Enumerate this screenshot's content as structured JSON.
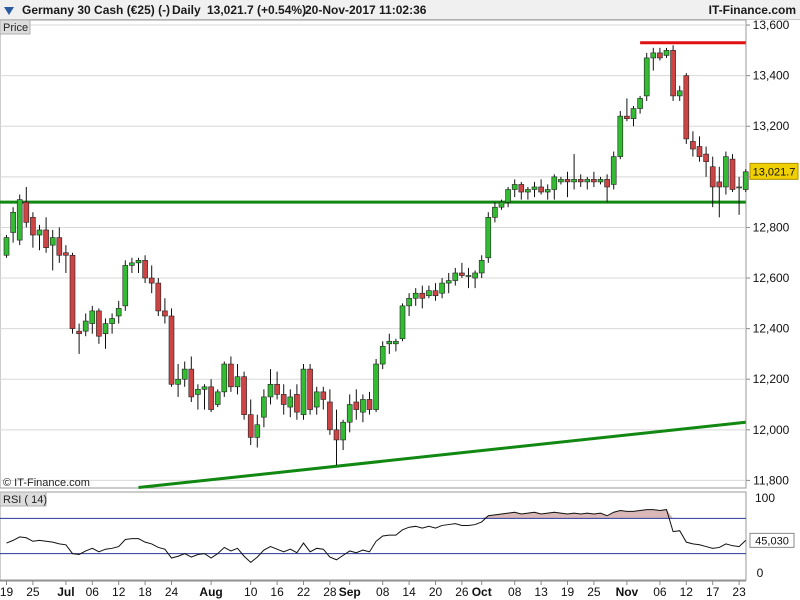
{
  "header": {
    "instrument": "Germany 30 Cash (€25) (-)",
    "period": "Daily",
    "quote": "13,021.7 (+0.54%)",
    "datetime": "20-Nov-2017 11:02:36",
    "brand": "IT-Finance.com"
  },
  "price_panel": {
    "label": "Price",
    "copyright": "© IT-Finance.com"
  },
  "rsi_panel": {
    "label": "RSI ( 14)"
  },
  "chart_data": [
    {
      "type": "candlestick",
      "title": "Germany 30 Cash (€25) (-)",
      "ylim": [
        11770,
        13620
      ],
      "y_ticks": [
        11800,
        12000,
        12200,
        12400,
        12600,
        12800,
        13000,
        13200,
        13400,
        13600
      ],
      "y_tick_labels": [
        "11,800",
        "12,000",
        "12,200",
        "12,400",
        "12,600",
        "12,800",
        "",
        "13,200",
        "13,400",
        "13,600"
      ],
      "last_price": 13021.7,
      "last_price_label": "13,021.7",
      "x_ticks": [
        {
          "label": "19",
          "idx": 0,
          "bold": false
        },
        {
          "label": "25",
          "idx": 4,
          "bold": false
        },
        {
          "label": "Jul",
          "idx": 9,
          "bold": true
        },
        {
          "label": "06",
          "idx": 13,
          "bold": false
        },
        {
          "label": "12",
          "idx": 17,
          "bold": false
        },
        {
          "label": "18",
          "idx": 21,
          "bold": false
        },
        {
          "label": "24",
          "idx": 25,
          "bold": false
        },
        {
          "label": "Aug",
          "idx": 31,
          "bold": true
        },
        {
          "label": "10",
          "idx": 37,
          "bold": false
        },
        {
          "label": "16",
          "idx": 41,
          "bold": false
        },
        {
          "label": "22",
          "idx": 45,
          "bold": false
        },
        {
          "label": "28",
          "idx": 49,
          "bold": false
        },
        {
          "label": "Sep",
          "idx": 52,
          "bold": true
        },
        {
          "label": "08",
          "idx": 57,
          "bold": false
        },
        {
          "label": "14",
          "idx": 61,
          "bold": false
        },
        {
          "label": "20",
          "idx": 65,
          "bold": false
        },
        {
          "label": "26",
          "idx": 69,
          "bold": false
        },
        {
          "label": "Oct",
          "idx": 72,
          "bold": true
        },
        {
          "label": "08",
          "idx": 77,
          "bold": false
        },
        {
          "label": "13",
          "idx": 81,
          "bold": false
        },
        {
          "label": "19",
          "idx": 85,
          "bold": false
        },
        {
          "label": "25",
          "idx": 89,
          "bold": false
        },
        {
          "label": "Nov",
          "idx": 94,
          "bold": true
        },
        {
          "label": "06",
          "idx": 99,
          "bold": false
        },
        {
          "label": "12",
          "idx": 103,
          "bold": false
        },
        {
          "label": "17",
          "idx": 107,
          "bold": false
        },
        {
          "label": "23",
          "idx": 111,
          "bold": false
        }
      ],
      "candles": [
        [
          12690,
          12770,
          12680,
          12760
        ],
        [
          12780,
          12880,
          12740,
          12860
        ],
        [
          12750,
          12930,
          12730,
          12910
        ],
        [
          12900,
          12960,
          12800,
          12820
        ],
        [
          12840,
          12860,
          12720,
          12770
        ],
        [
          12770,
          12810,
          12710,
          12790
        ],
        [
          12790,
          12840,
          12700,
          12720
        ],
        [
          12730,
          12790,
          12630,
          12760
        ],
        [
          12760,
          12800,
          12660,
          12690
        ],
        [
          12700,
          12730,
          12620,
          12690
        ],
        [
          12690,
          12700,
          12380,
          12400
        ],
        [
          12390,
          12420,
          12300,
          12380
        ],
        [
          12390,
          12460,
          12370,
          12430
        ],
        [
          12420,
          12490,
          12380,
          12470
        ],
        [
          12470,
          12480,
          12340,
          12370
        ],
        [
          12380,
          12440,
          12320,
          12420
        ],
        [
          12420,
          12460,
          12380,
          12440
        ],
        [
          12450,
          12510,
          12420,
          12480
        ],
        [
          12490,
          12670,
          12470,
          12650
        ],
        [
          12650,
          12680,
          12620,
          12660
        ],
        [
          12660,
          12680,
          12620,
          12670
        ],
        [
          12670,
          12690,
          12580,
          12600
        ],
        [
          12600,
          12650,
          12540,
          12580
        ],
        [
          12580,
          12600,
          12450,
          12470
        ],
        [
          12470,
          12520,
          12420,
          12450
        ],
        [
          12450,
          12480,
          12170,
          12180
        ],
        [
          12180,
          12260,
          12130,
          12200
        ],
        [
          12200,
          12270,
          12170,
          12240
        ],
        [
          12240,
          12290,
          12110,
          12130
        ],
        [
          12140,
          12180,
          12080,
          12160
        ],
        [
          12160,
          12180,
          12080,
          12170
        ],
        [
          12170,
          12200,
          12070,
          12080
        ],
        [
          12100,
          12160,
          12090,
          12150
        ],
        [
          12150,
          12270,
          12130,
          12260
        ],
        [
          12260,
          12290,
          12150,
          12170
        ],
        [
          12170,
          12260,
          12140,
          12210
        ],
        [
          12210,
          12230,
          12040,
          12060
        ],
        [
          12060,
          12120,
          11940,
          11970
        ],
        [
          11970,
          12060,
          11930,
          12020
        ],
        [
          12050,
          12160,
          12010,
          12130
        ],
        [
          12130,
          12240,
          12100,
          12180
        ],
        [
          12180,
          12230,
          12120,
          12140
        ],
        [
          12140,
          12180,
          12060,
          12100
        ],
        [
          12090,
          12160,
          12050,
          12130
        ],
        [
          12140,
          12180,
          12040,
          12070
        ],
        [
          12060,
          12260,
          12040,
          12240
        ],
        [
          12240,
          12260,
          12060,
          12080
        ],
        [
          12090,
          12170,
          12060,
          12150
        ],
        [
          12150,
          12170,
          12080,
          12120
        ],
        [
          12110,
          12160,
          11980,
          12000
        ],
        [
          12000,
          12080,
          11860,
          11960
        ],
        [
          11960,
          12040,
          11920,
          12030
        ],
        [
          12030,
          12140,
          11990,
          12100
        ],
        [
          12110,
          12160,
          12040,
          12080
        ],
        [
          12070,
          12140,
          12030,
          12120
        ],
        [
          12120,
          12150,
          12060,
          12080
        ],
        [
          12080,
          12280,
          12070,
          12260
        ],
        [
          12260,
          12350,
          12240,
          12330
        ],
        [
          12340,
          12380,
          12300,
          12350
        ],
        [
          12340,
          12360,
          12310,
          12350
        ],
        [
          12360,
          12500,
          12350,
          12490
        ],
        [
          12490,
          12540,
          12450,
          12520
        ],
        [
          12520,
          12560,
          12490,
          12540
        ],
        [
          12540,
          12570,
          12480,
          12520
        ],
        [
          12530,
          12570,
          12520,
          12550
        ],
        [
          12550,
          12580,
          12510,
          12530
        ],
        [
          12540,
          12600,
          12520,
          12580
        ],
        [
          12580,
          12620,
          12540,
          12590
        ],
        [
          12590,
          12640,
          12570,
          12620
        ],
        [
          12620,
          12660,
          12600,
          12610
        ],
        [
          12610,
          12640,
          12560,
          12610
        ],
        [
          12600,
          12630,
          12560,
          12620
        ],
        [
          12620,
          12690,
          12600,
          12670
        ],
        [
          12680,
          12860,
          12660,
          12840
        ],
        [
          12840,
          12900,
          12820,
          12880
        ],
        [
          12880,
          12910,
          12870,
          12900
        ],
        [
          12900,
          12960,
          12880,
          12950
        ],
        [
          12950,
          12990,
          12920,
          12970
        ],
        [
          12970,
          12980,
          12910,
          12940
        ],
        [
          12940,
          12960,
          12910,
          12950
        ],
        [
          12950,
          12980,
          12920,
          12960
        ],
        [
          12960,
          12990,
          12930,
          12940
        ],
        [
          12940,
          12970,
          12910,
          12950
        ],
        [
          12950,
          13010,
          12910,
          13000
        ],
        [
          12980,
          13000,
          12970,
          12990
        ],
        [
          12990,
          13020,
          12920,
          12980
        ],
        [
          12980,
          13090,
          12950,
          12990
        ],
        [
          12990,
          13010,
          12960,
          12980
        ],
        [
          12980,
          13000,
          12950,
          12990
        ],
        [
          12990,
          13020,
          12960,
          12980
        ],
        [
          12980,
          13000,
          12970,
          12990
        ],
        [
          12990,
          13010,
          12900,
          12960
        ],
        [
          12970,
          13100,
          12950,
          13080
        ],
        [
          13080,
          13260,
          13070,
          13240
        ],
        [
          13240,
          13310,
          13220,
          13230
        ],
        [
          13230,
          13280,
          13200,
          13270
        ],
        [
          13270,
          13320,
          13250,
          13310
        ],
        [
          13320,
          13490,
          13300,
          13470
        ],
        [
          13470,
          13510,
          13420,
          13490
        ],
        [
          13490,
          13510,
          13460,
          13470
        ],
        [
          13480,
          13510,
          13470,
          13500
        ],
        [
          13500,
          13520,
          13300,
          13320
        ],
        [
          13320,
          13360,
          13300,
          13340
        ],
        [
          13400,
          13410,
          13130,
          13150
        ],
        [
          13140,
          13180,
          13080,
          13110
        ],
        [
          13120,
          13160,
          13060,
          13080
        ],
        [
          13090,
          13120,
          13000,
          13060
        ],
        [
          13040,
          13080,
          12880,
          12960
        ],
        [
          12980,
          13040,
          12840,
          12960
        ],
        [
          12960,
          13100,
          12930,
          13080
        ],
        [
          13070,
          13090,
          12940,
          12950
        ],
        [
          12960,
          13000,
          12850,
          12960
        ],
        [
          12950,
          13030,
          12940,
          13020
        ]
      ],
      "lines": [
        {
          "name": "resistance",
          "color": "#e01010",
          "from": [
            96,
            13530
          ],
          "to": [
            112,
            13530
          ]
        },
        {
          "name": "support-horizontal",
          "color": "#118811",
          "from": [
            -2,
            12900
          ],
          "to": [
            112,
            12900
          ]
        },
        {
          "name": "trendline",
          "color": "#118811",
          "from": [
            20,
            11772
          ],
          "to": [
            112,
            12030
          ]
        }
      ],
      "colors": {
        "up": "#33bb33",
        "down": "#cc4444",
        "wick": "#111111"
      }
    },
    {
      "type": "line",
      "title": "RSI ( 14)",
      "ylim": [
        0,
        100
      ],
      "y_tick_labels": [
        "100",
        "0"
      ],
      "levels": [
        70,
        30
      ],
      "last_value": 45.03,
      "last_value_label": "45,030",
      "overbought_fill": "#dbb8b8",
      "values": [
        42,
        45,
        49,
        48,
        44,
        45,
        44,
        43,
        41,
        40,
        30,
        29,
        33,
        36,
        32,
        35,
        36,
        38,
        46,
        47,
        47,
        43,
        41,
        37,
        35,
        25,
        27,
        30,
        26,
        29,
        30,
        25,
        30,
        37,
        33,
        36,
        27,
        20,
        26,
        34,
        38,
        35,
        32,
        35,
        31,
        42,
        32,
        36,
        35,
        26,
        23,
        28,
        33,
        31,
        34,
        32,
        44,
        50,
        51,
        51,
        57,
        60,
        61,
        59,
        61,
        59,
        62,
        63,
        64,
        62,
        62,
        63,
        66,
        73,
        74,
        75,
        76,
        77,
        75,
        76,
        77,
        75,
        76,
        77,
        76,
        75,
        76,
        75,
        76,
        75,
        76,
        73,
        77,
        79,
        78,
        78,
        79,
        80,
        80,
        79,
        80,
        55,
        56,
        43,
        41,
        40,
        38,
        36,
        37,
        41,
        39,
        38,
        45
      ]
    }
  ]
}
